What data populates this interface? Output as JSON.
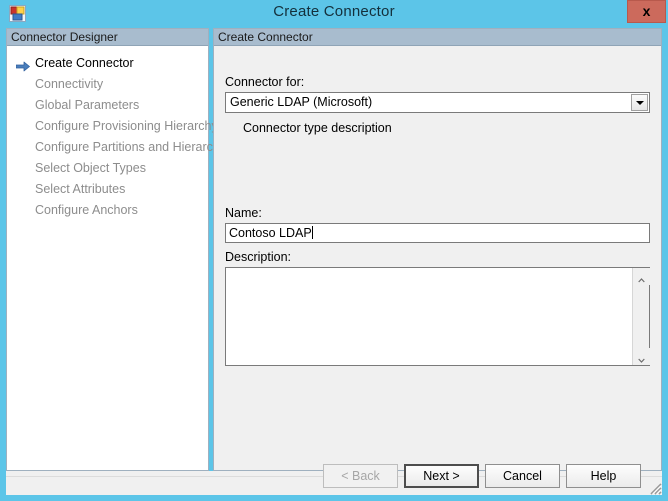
{
  "window": {
    "title": "Create Connector",
    "icon": "connector-designer-icon",
    "close_label": "x",
    "border_color": "#5cc5e8",
    "titlebar_text_color": "#14303c",
    "close_button_color": "#cc6a5c"
  },
  "sidebar": {
    "header": "Connector Designer",
    "current_index": 0,
    "items": [
      {
        "label": "Create Connector",
        "state": "current"
      },
      {
        "label": "Connectivity",
        "state": "disabled"
      },
      {
        "label": "Global Parameters",
        "state": "disabled"
      },
      {
        "label": "Configure Provisioning Hierarchy",
        "state": "disabled"
      },
      {
        "label": "Configure Partitions and Hierarchies",
        "state": "disabled"
      },
      {
        "label": "Select Object Types",
        "state": "disabled"
      },
      {
        "label": "Select Attributes",
        "state": "disabled"
      },
      {
        "label": "Configure Anchors",
        "state": "disabled"
      }
    ]
  },
  "main": {
    "header": "Create Connector",
    "connector_for": {
      "label": "Connector for:",
      "selected": "Generic LDAP (Microsoft)",
      "options": [
        "Generic LDAP (Microsoft)"
      ],
      "description": "Connector type description"
    },
    "name": {
      "label": "Name:",
      "value": "Contoso LDAP",
      "placeholder": ""
    },
    "description": {
      "label": "Description:",
      "value": "",
      "placeholder": ""
    }
  },
  "footer": {
    "buttons": [
      {
        "label": "< Back",
        "state": "disabled"
      },
      {
        "label": "Next >",
        "state": "default"
      },
      {
        "label": "Cancel",
        "state": "normal"
      },
      {
        "label": "Help",
        "state": "normal"
      }
    ]
  }
}
